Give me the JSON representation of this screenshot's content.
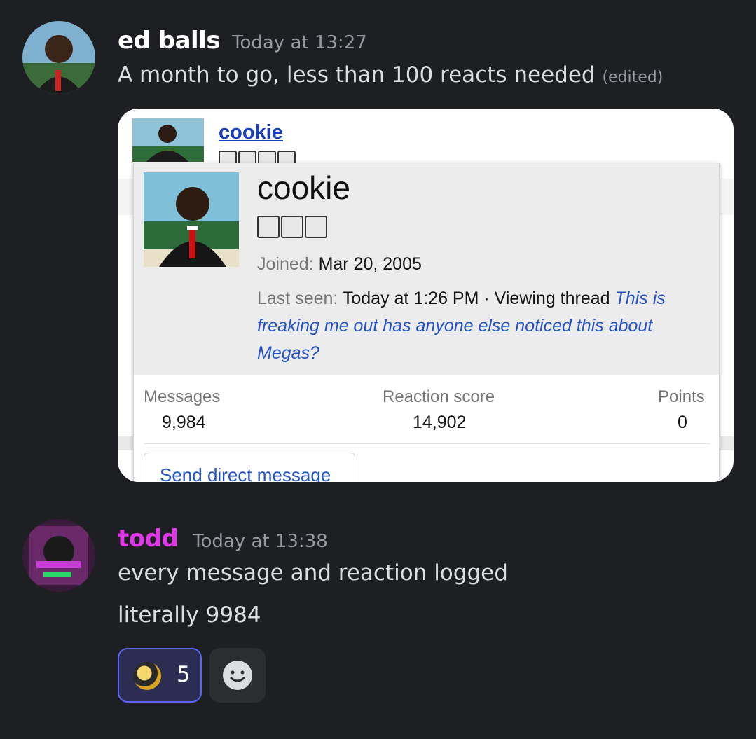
{
  "messages": [
    {
      "username": "ed balls",
      "username_color": "#ffffff",
      "timestamp": "Today at 13:27",
      "lines": [
        "A month to go, less than 100 reacts needed"
      ],
      "edited_label": "(edited)",
      "embed": {
        "mini_name": "cookie",
        "card": {
          "name": "cookie",
          "joined_label": "Joined:",
          "joined_value": "Mar 20, 2005",
          "last_seen_label": "Last seen:",
          "last_seen_value": "Today at 1:26 PM · Viewing thread",
          "thread_title": "This is freaking me out has anyone else noticed this about Megas?",
          "stats": [
            {
              "label": "Messages",
              "value": "9,984"
            },
            {
              "label": "Reaction score",
              "value": "14,902"
            },
            {
              "label": "Points",
              "value": "0"
            }
          ],
          "dm_button": "Send direct message"
        }
      }
    },
    {
      "username": "todd",
      "username_color": "#e038e8",
      "timestamp": "Today at 13:38",
      "lines": [
        "every message and reaction logged",
        "literally 9984"
      ],
      "reactions": [
        {
          "emoji_icon": "custom-emoji-icon",
          "count": "5"
        }
      ]
    }
  ],
  "colors": {
    "background": "#1e1f22",
    "link": "#1a3fbf",
    "reaction_border": "#5865f2"
  }
}
